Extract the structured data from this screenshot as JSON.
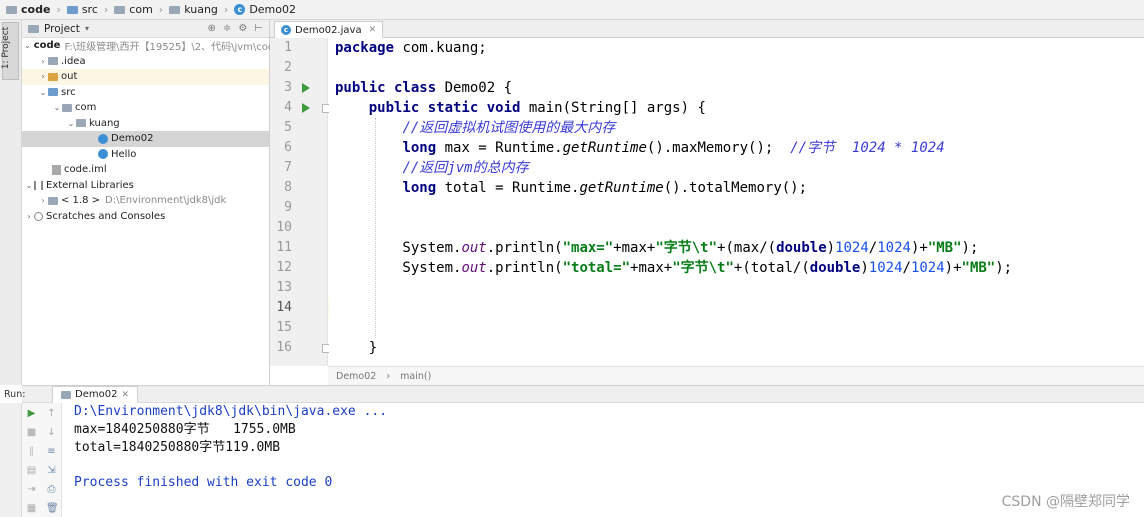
{
  "navbar": {
    "crumbs": [
      "code",
      "src",
      "com",
      "kuang",
      "Demo02"
    ]
  },
  "left_strip": {
    "tab_label": "1: Project"
  },
  "project_panel": {
    "title": "Project",
    "tree": [
      {
        "label": "code",
        "detail": "F:\\班级管理\\西开【19525】\\2、代码\\jvm\\code"
      },
      {
        "label": ".idea"
      },
      {
        "label": "out"
      },
      {
        "label": "src"
      },
      {
        "label": "com"
      },
      {
        "label": "kuang"
      },
      {
        "label": "Demo02"
      },
      {
        "label": "Hello"
      },
      {
        "label": "code.iml"
      },
      {
        "label": "External Libraries"
      },
      {
        "label": "< 1.8 >",
        "detail": "D:\\Environment\\jdk8\\jdk"
      },
      {
        "label": "Scratches and Consoles"
      }
    ]
  },
  "editor": {
    "tab_label": "Demo02.java",
    "line_numbers": [
      "1",
      "2",
      "3",
      "4",
      "5",
      "6",
      "7",
      "8",
      "9",
      "10",
      "11",
      "12",
      "13",
      "14",
      "15",
      "16"
    ],
    "current_line": 14,
    "breadcrumb": [
      "Demo02",
      "main()"
    ]
  },
  "run_panel": {
    "label": "Run:",
    "tab_label": "Demo02",
    "console_lines": [
      "D:\\Environment\\jdk8\\jdk\\bin\\java.exe ...",
      "max=1840250880字节",
      "1755.0MB",
      "total=1840250880字节",
      "119.0MB",
      "Process finished with exit code 0"
    ]
  },
  "watermark": "CSDN @隔壁郑同学"
}
